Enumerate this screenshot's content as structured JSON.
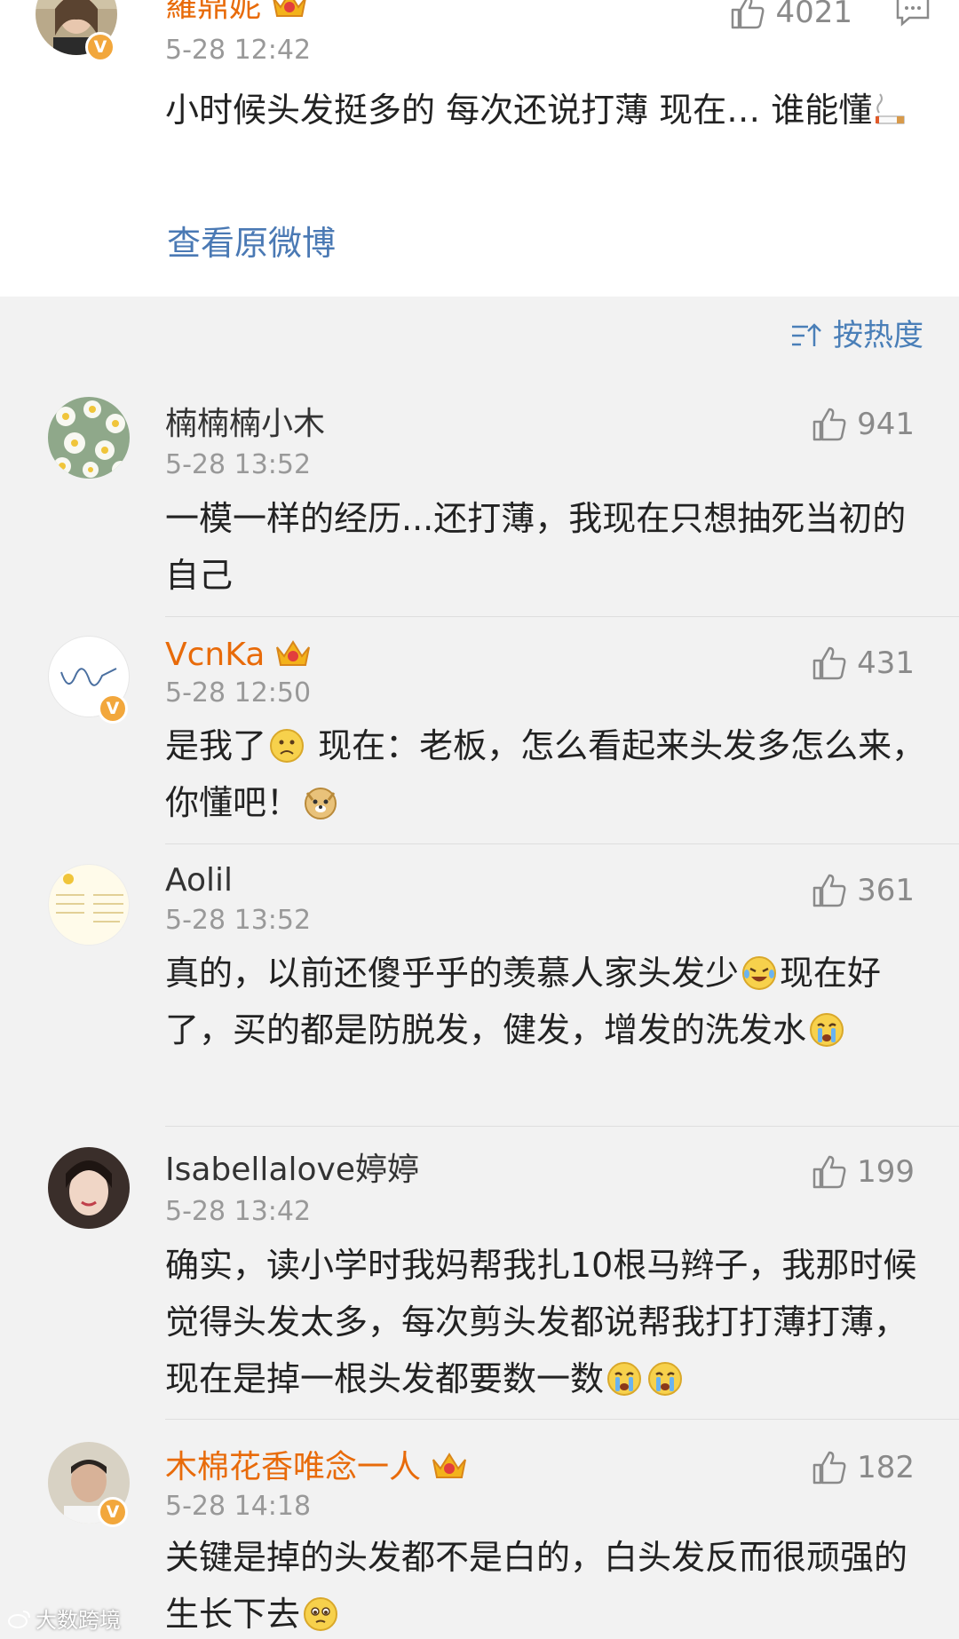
{
  "post": {
    "author": "羅鼎妮",
    "timestamp": "5-28 12:42",
    "likes": "4021",
    "text": "小时候头发挺多的 每次还说打薄 现在… 谁能懂",
    "view_original": "查看原微博"
  },
  "sort_label": "按热度",
  "comments": [
    {
      "name": "楠楠楠小木",
      "time": "5-28 13:52",
      "likes": "941",
      "text_a": "一模一样的经历...还打薄，我现在只想抽死当初的自己",
      "text_b": "",
      "text_c": ""
    },
    {
      "name": "VcnKa",
      "time": "5-28 12:50",
      "likes": "431",
      "text_a": "是我了",
      "text_b": " 现在：老板，怎么看起来头发多怎么来，你懂吧！",
      "text_c": ""
    },
    {
      "name": "Aolil",
      "time": "5-28 13:52",
      "likes": "361",
      "text_a": "真的，以前还傻乎乎的羡慕人家头发少",
      "text_b": "现在好了，买的都是防脱发，健发，增发的洗发水",
      "text_c": ""
    },
    {
      "name": "Isabellalove婷婷",
      "time": "5-28 13:42",
      "likes": "199",
      "text_a": "确实，读小学时我妈帮我扎10根马辫子，我那时候觉得头发太多，每次剪头发都说帮我打打薄打薄，现在是掉一根头发都要数一数",
      "text_b": "",
      "text_c": ""
    },
    {
      "name": "木棉花香唯念一人",
      "time": "5-28 14:18",
      "likes": "182",
      "text_a": "关键是掉的头发都不是白的，白头发反而很顽强的生长下去",
      "text_b": "",
      "text_c": ""
    }
  ],
  "watermark": "大数跨境",
  "colors": {
    "vip_name": "#e86b0a",
    "link": "#4a79b4",
    "verified_badge": "#f2a73c"
  }
}
